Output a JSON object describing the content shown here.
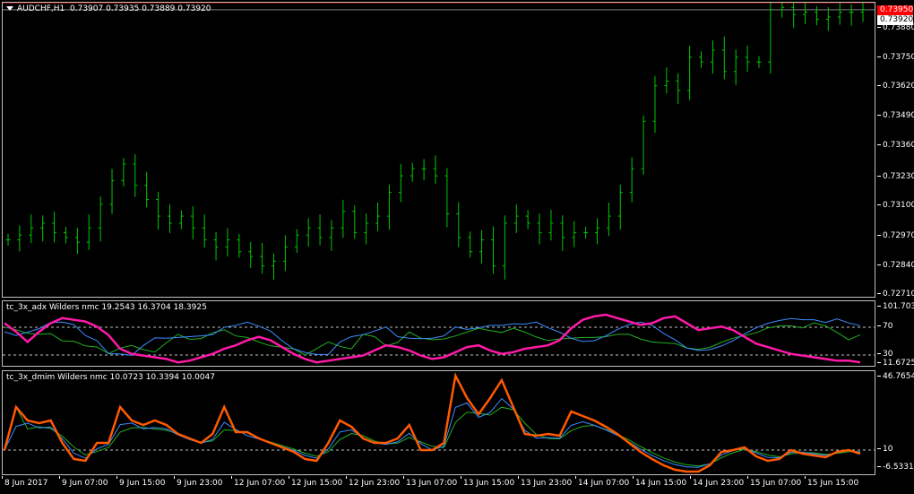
{
  "symbol": {
    "name": "AUDCHF,H1",
    "open": "0.73907",
    "high": "0.73935",
    "low": "0.73889",
    "close": "0.73920"
  },
  "price_axis": {
    "ticks": [
      "0.73880",
      "0.73750",
      "0.73620",
      "0.73490",
      "0.73360",
      "0.73230",
      "0.73100",
      "0.72970",
      "0.72840",
      "0.72710"
    ],
    "ask_tag": "0.73950",
    "bid_tag": "0.73920",
    "ask_color": "#ff0000",
    "bid_color": "#ffffff"
  },
  "adx_panel": {
    "title": "tc_3x_adx Wilders nmc 19.2543 16.3704 18.3925",
    "levels": [
      "101.7034",
      "70",
      "30",
      "11.6725"
    ]
  },
  "dmim_panel": {
    "title": "tc_3x_dmim Wilders nmc 10.0723 10.3394 10.0047",
    "levels": [
      "46.7654",
      "10",
      "-6.5331"
    ]
  },
  "time_axis": [
    "8 Jun 2017",
    "9 Jun 07:00",
    "9 Jun 15:00",
    "9 Jun 23:00",
    "12 Jun 07:00",
    "12 Jun 15:00",
    "12 Jun 23:00",
    "13 Jun 07:00",
    "13 Jun 15:00",
    "13 Jun 23:00",
    "14 Jun 07:00",
    "14 Jun 15:00",
    "14 Jun 23:00",
    "15 Jun 07:00",
    "15 Jun 15:00"
  ],
  "colors": {
    "bars": "#00c800",
    "magenta": "#ff1aa8",
    "blue": "#3c8cff",
    "green": "#22b022",
    "orange": "#ff5a00"
  },
  "chart_data": {
    "type": "ohlc-bars",
    "symbol": "AUDCHF",
    "timeframe": "H1",
    "close_approx": [
      0.7295,
      0.7297,
      0.73,
      0.7302,
      0.7298,
      0.7296,
      0.7294,
      0.73,
      0.731,
      0.732,
      0.7327,
      0.7318,
      0.7312,
      0.7305,
      0.7302,
      0.7305,
      0.73,
      0.7295,
      0.7292,
      0.7295,
      0.729,
      0.7288,
      0.7284,
      0.7286,
      0.7292,
      0.7297,
      0.73,
      0.7296,
      0.73,
      0.7307,
      0.7298,
      0.7302,
      0.7305,
      0.7315,
      0.7322,
      0.7325,
      0.7325,
      0.7322,
      0.7306,
      0.7296,
      0.729,
      0.7295,
      0.7284,
      0.7302,
      0.7305,
      0.7302,
      0.7298,
      0.7302,
      0.7296,
      0.7298,
      0.7298,
      0.73,
      0.7305,
      0.7315,
      0.7325,
      0.7345,
      0.736,
      0.7362,
      0.7358,
      0.7372,
      0.737,
      0.7375,
      0.7366,
      0.7372,
      0.737,
      0.737,
      0.7392,
      0.7393,
      0.739,
      0.7391,
      0.7388,
      0.7389,
      0.7391,
      0.7391,
      0.7392
    ],
    "ylim": [
      0.7271,
      0.7395
    ]
  }
}
